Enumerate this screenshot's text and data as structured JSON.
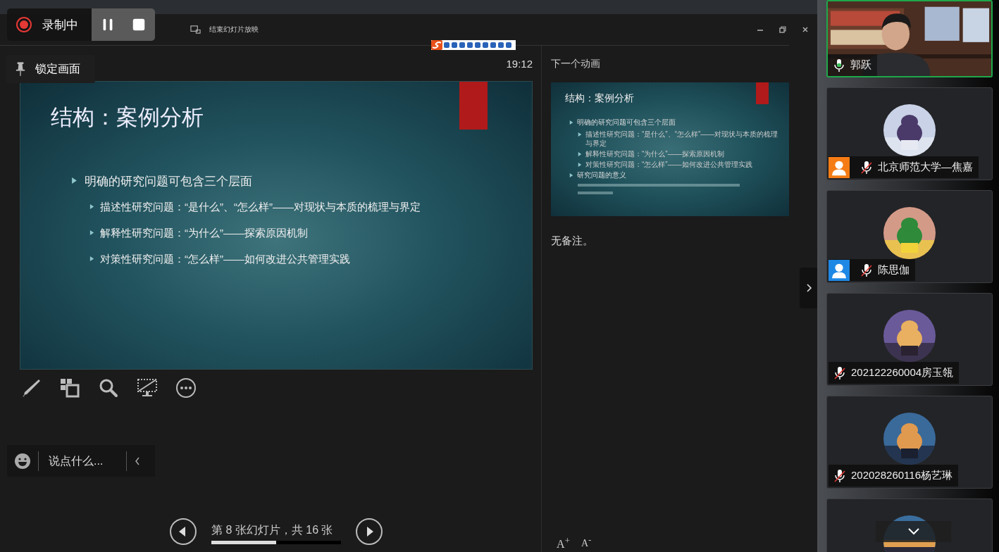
{
  "recording": {
    "label": "录制中"
  },
  "presenter_toolbar": {
    "end_show": "结束幻灯片放映"
  },
  "lock_tooltip": {
    "label": "锁定画面"
  },
  "clock": "19:12",
  "current_slide": {
    "title": "结构：案例分析",
    "bullets": [
      {
        "text": "明确的研究问题可包含三个层面",
        "children": [
          {
            "text": "描述性研究问题：“是什么”、“怎么样”——对现状与本质的梳理与界定"
          },
          {
            "text": "解释性研究问题：“为什么”——探索原因机制"
          },
          {
            "text": "对策性研究问题：“怎么样”——如何改进公共管理实践"
          }
        ]
      }
    ]
  },
  "next_pane": {
    "label": "下一个动画",
    "slide": {
      "title": "结构：案例分析",
      "bullets": [
        {
          "text": "明确的研究问题可包含三个层面",
          "children": [
            {
              "text": "描述性研究问题：“是什么”、“怎么样”——对现状与本质的梳理与界定"
            },
            {
              "text": "解释性研究问题：“为什么”——探索原因机制"
            },
            {
              "text": "对策性研究问题：“怎么样”——如何改进公共管理实践"
            }
          ]
        },
        {
          "text": "研究问题的意义"
        }
      ]
    },
    "notes": "无备注。",
    "font_buttons": [
      {
        "kind": "increase",
        "label": "A$^{+}$"
      },
      {
        "kind": "decrease",
        "label": "A$^{-}$"
      }
    ]
  },
  "chat": {
    "placeholder": "说点什么..."
  },
  "navigation": {
    "position": "第 8 张幻灯片，共 16 张",
    "level": 0.5
  },
  "participants": [
    {
      "name": "郭跃",
      "kind": "video",
      "mic_on": true,
      "speaking": true
    },
    {
      "name": "北京师范大学—焦嘉",
      "kind": "avatar",
      "mic_on": false,
      "speaking": false,
      "color": "#f57c14"
    },
    {
      "name": "陈思伽",
      "kind": "avatar",
      "mic_on": false,
      "speaking": false,
      "color": "#1e88e5"
    },
    {
      "name": "202122260004房玉瓴",
      "kind": "avatar",
      "mic_on": false,
      "speaking": false
    },
    {
      "name": "202028260116杨艺琳",
      "kind": "avatar",
      "mic_on": false,
      "speaking": false
    },
    {
      "kind": "avatar_cut",
      "speaking": false
    }
  ]
}
